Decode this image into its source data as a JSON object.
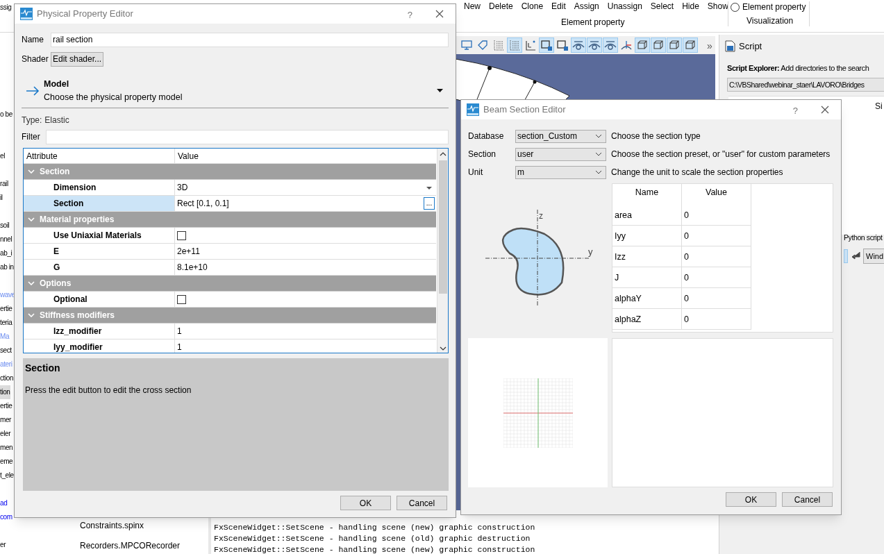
{
  "app": {
    "ribbon": {
      "cut_label": "ssig",
      "buttons": [
        "New",
        "Delete",
        "Clone",
        "Edit",
        "Assign",
        "Unassign",
        "Select",
        "Hide",
        "Show"
      ],
      "group_label": "Element property",
      "radio": {
        "label": "Element property",
        "selected": false
      },
      "radio_group_label": "Visualization"
    },
    "toolbar": [
      {
        "kind": "monitor",
        "selected": false
      },
      {
        "kind": "tag",
        "selected": false
      },
      {
        "kind": "grid",
        "selected": false
      },
      {
        "kind": "grid",
        "selected": true
      },
      {
        "kind": "angle",
        "selected": false
      },
      {
        "kind": "square",
        "selected": true
      },
      {
        "kind": "square",
        "selected": false
      },
      {
        "kind": "eye",
        "selected": true
      },
      {
        "kind": "eye",
        "selected": true
      },
      {
        "kind": "eye",
        "selected": true
      },
      {
        "kind": "axes",
        "selected": false
      },
      {
        "kind": "cube",
        "selected": true
      },
      {
        "kind": "cube",
        "selected": true
      },
      {
        "kind": "cube",
        "selected": true
      },
      {
        "kind": "cube",
        "selected": true
      }
    ],
    "toolbar_more": "»",
    "tree": [
      {
        "text": "o be",
        "kind": "plain",
        "selected": false
      },
      {
        "text": "el",
        "kind": "plain",
        "selected": false
      },
      {
        "text": "rail",
        "kind": "plain",
        "selected": false
      },
      {
        "text": "il",
        "kind": "plain",
        "selected": false
      },
      {
        "text": "soil",
        "kind": "plain",
        "selected": false
      },
      {
        "text": "nnel",
        "kind": "plain",
        "selected": false
      },
      {
        "text": "ab_i",
        "kind": "plain",
        "selected": false
      },
      {
        "text": "ab in",
        "kind": "plain",
        "selected": false
      },
      {
        "text": "wave",
        "kind": "light",
        "selected": false
      },
      {
        "text": "ertie",
        "kind": "plain",
        "selected": false
      },
      {
        "text": "teria",
        "kind": "plain",
        "selected": false
      },
      {
        "text": "Ma",
        "kind": "light",
        "selected": false
      },
      {
        "text": "sect",
        "kind": "plain",
        "selected": false
      },
      {
        "text": "ateri",
        "kind": "light",
        "selected": false
      },
      {
        "text": "ction",
        "kind": "plain",
        "selected": false
      },
      {
        "text": "tion",
        "kind": "plain",
        "selected": true
      },
      {
        "text": "ertie",
        "kind": "plain",
        "selected": false
      },
      {
        "text": "mer",
        "kind": "plain",
        "selected": false
      },
      {
        "text": "eler",
        "kind": "plain",
        "selected": false
      },
      {
        "text": "men",
        "kind": "plain",
        "selected": false
      },
      {
        "text": "eme",
        "kind": "plain",
        "selected": false
      },
      {
        "text": "t_ele",
        "kind": "plain",
        "selected": false
      },
      {
        "text": "ad",
        "kind": "link",
        "selected": false
      },
      {
        "text": "com",
        "kind": "link",
        "selected": false
      },
      {
        "text": "er",
        "kind": "plain",
        "selected": false
      }
    ],
    "files": [
      "Constraints.spinx",
      "Recorders.MPCORecorder"
    ],
    "script_panel": {
      "title": "Script",
      "explorer_label": "Script Explorer:",
      "explorer_text": "Add directories to the search",
      "path": "C:\\VBShared\\webinar_staer\\LAVORO\\Bridges",
      "column": "Si",
      "python_label": "Python script",
      "wind_button": "Wind"
    },
    "console": [
      "FxSceneWidget::SetScene - handling scene (new) graphic construction",
      "FxSceneWidget::SetScene - handling scene (old) graphic destruction",
      "FxSceneWidget::SetScene - handling scene (new) graphic construction"
    ]
  },
  "physical_property_editor": {
    "title": "Physical Property Editor",
    "help": "?",
    "name_label": "Name",
    "name_value": "rail section",
    "shader_label": "Shader",
    "shader_button": "Edit shader...",
    "model_title": "Model",
    "model_subtitle": "Choose the physical property model",
    "type_label": "Type:",
    "type_value": "Elastic",
    "filter_label": "Filter",
    "columns": [
      "Attribute",
      "Value"
    ],
    "groups": [
      {
        "title": "Section",
        "expanded": true,
        "rows": [
          {
            "name": "Dimension",
            "kind": "dropdown",
            "value": "3D",
            "selected": false
          },
          {
            "name": "Section",
            "kind": "edit",
            "value": "Rect [0.1, 0.1]",
            "button": "...",
            "selected": true
          }
        ]
      },
      {
        "title": "Material properties",
        "expanded": true,
        "rows": [
          {
            "name": "Use Uniaxial Materials",
            "kind": "checkbox",
            "checked": false,
            "selected": false
          },
          {
            "name": "E",
            "kind": "text",
            "value": "2e+11",
            "selected": false
          },
          {
            "name": "G",
            "kind": "text",
            "value": "8.1e+10",
            "selected": false
          }
        ]
      },
      {
        "title": "Options",
        "expanded": true,
        "rows": [
          {
            "name": "Optional",
            "kind": "checkbox",
            "checked": false,
            "selected": false
          }
        ]
      },
      {
        "title": "Stiffness modifiers",
        "expanded": true,
        "rows": [
          {
            "name": "Izz_modifier",
            "kind": "text",
            "value": "1",
            "selected": false
          },
          {
            "name": "Iyy_modifier",
            "kind": "text",
            "value": "1",
            "selected": false
          }
        ]
      }
    ],
    "description_title": "Section",
    "description_text": "Press the edit button to edit the cross section",
    "ok": "OK",
    "cancel": "Cancel"
  },
  "beam_section_editor": {
    "title": "Beam Section Editor",
    "help": "?",
    "fields": [
      {
        "label": "Database",
        "value": "section_Custom",
        "hint": "Choose the section type"
      },
      {
        "label": "Section",
        "value": "user",
        "hint": "Choose the section preset, or \"user\" for custom parameters"
      },
      {
        "label": "Unit",
        "value": "m",
        "hint": "Change the unit to scale the section properties"
      }
    ],
    "axis_z": "z",
    "axis_y": "y",
    "columns": [
      "Name",
      "Value"
    ],
    "properties": [
      {
        "name": "area",
        "value": "0"
      },
      {
        "name": "Iyy",
        "value": "0"
      },
      {
        "name": "Izz",
        "value": "0"
      },
      {
        "name": "J",
        "value": "0"
      },
      {
        "name": "alphaY",
        "value": "0"
      },
      {
        "name": "alphaZ",
        "value": "0"
      }
    ],
    "ok": "OK",
    "cancel": "Cancel"
  }
}
